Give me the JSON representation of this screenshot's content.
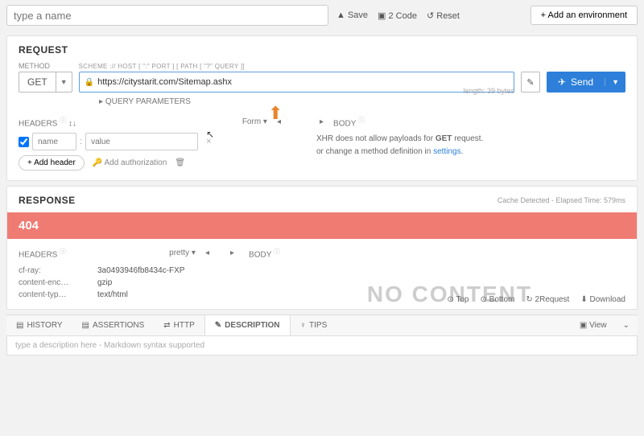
{
  "top": {
    "name_placeholder": "type a name",
    "save": "Save",
    "code": "2 Code",
    "reset": "Reset",
    "add_env": "+  Add an environment"
  },
  "request": {
    "title": "REQUEST",
    "method_label": "METHOD",
    "method": "GET",
    "url_hint": "SCHEME :// HOST [ \":\" PORT ] [ PATH [ \"?\" QUERY ]]",
    "url": "https://citystarit.com/Sitemap.ashx",
    "length_label": "length: 39 bytes",
    "send": "Send",
    "query_params": "QUERY PARAMETERS",
    "headers_label": "HEADERS",
    "form_label": "Form",
    "body_label": "BODY",
    "header_name_ph": "name",
    "header_value_ph": "value",
    "add_header": "+ Add header",
    "add_auth": "Add authorization",
    "body_msg_1": "XHR does not allow payloads for ",
    "body_msg_method": "GET",
    "body_msg_2": " request.",
    "body_msg_3": "or change a method definition in ",
    "body_msg_link": "settings"
  },
  "response": {
    "title": "RESPONSE",
    "meta": "Cache Detected - Elapsed Time: 579ms",
    "status": "404",
    "headers_label": "HEADERS",
    "pretty": "pretty",
    "body_label": "BODY",
    "headers": [
      {
        "k": "cf-ray:",
        "v": "3a0493946fb8434c-FXP"
      },
      {
        "k": "content-enc…",
        "v": "gzip"
      },
      {
        "k": "content-typ…",
        "v": "text/html"
      }
    ],
    "actions": {
      "top": "Top",
      "bottom": "Bottom",
      "req": "2Request",
      "download": "Download"
    },
    "watermark": "NO CONTENT"
  },
  "tabs": {
    "history": "HISTORY",
    "assertions": "ASSERTIONS",
    "http": "HTTP",
    "description": "DESCRIPTION",
    "tips": "TIPS",
    "view": "View"
  },
  "desc_placeholder": "type a description here - Markdown syntax supported"
}
